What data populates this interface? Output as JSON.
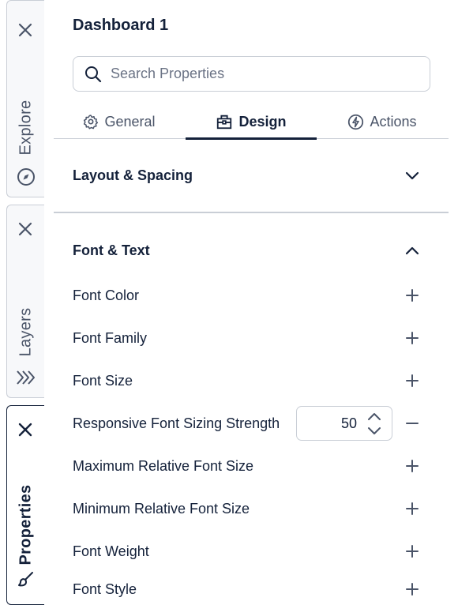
{
  "rail": {
    "tabs": [
      {
        "label": "Explore",
        "icon": "compass-icon",
        "active": false
      },
      {
        "label": "Layers",
        "icon": "layers-icon",
        "active": false
      },
      {
        "label": "Properties",
        "icon": "brush-icon",
        "active": true
      }
    ]
  },
  "panel": {
    "title": "Dashboard 1",
    "search": {
      "placeholder": "Search Properties",
      "value": ""
    },
    "tabs": [
      {
        "label": "General",
        "icon": "gear-icon",
        "active": false
      },
      {
        "label": "Design",
        "icon": "toolbox-icon",
        "active": true
      },
      {
        "label": "Actions",
        "icon": "bolt-icon",
        "active": false
      }
    ],
    "sections": {
      "layout": {
        "label": "Layout & Spacing",
        "expanded": false
      },
      "font": {
        "label": "Font & Text",
        "expanded": true,
        "properties": [
          {
            "label": "Font Color",
            "action": "add"
          },
          {
            "label": "Font Family",
            "action": "add"
          },
          {
            "label": "Font Size",
            "action": "add"
          },
          {
            "label": "Responsive Font Sizing Strength",
            "action": "remove",
            "value": "50"
          },
          {
            "label": "Maximum Relative Font Size",
            "action": "add"
          },
          {
            "label": "Minimum Relative Font Size",
            "action": "add"
          },
          {
            "label": "Font Weight",
            "action": "add"
          },
          {
            "label": "Font Style",
            "action": "add"
          }
        ]
      }
    }
  },
  "colors": {
    "text": "#14213a",
    "muted": "#4a5468",
    "border": "#c9ced6",
    "accent": "#14213a"
  }
}
